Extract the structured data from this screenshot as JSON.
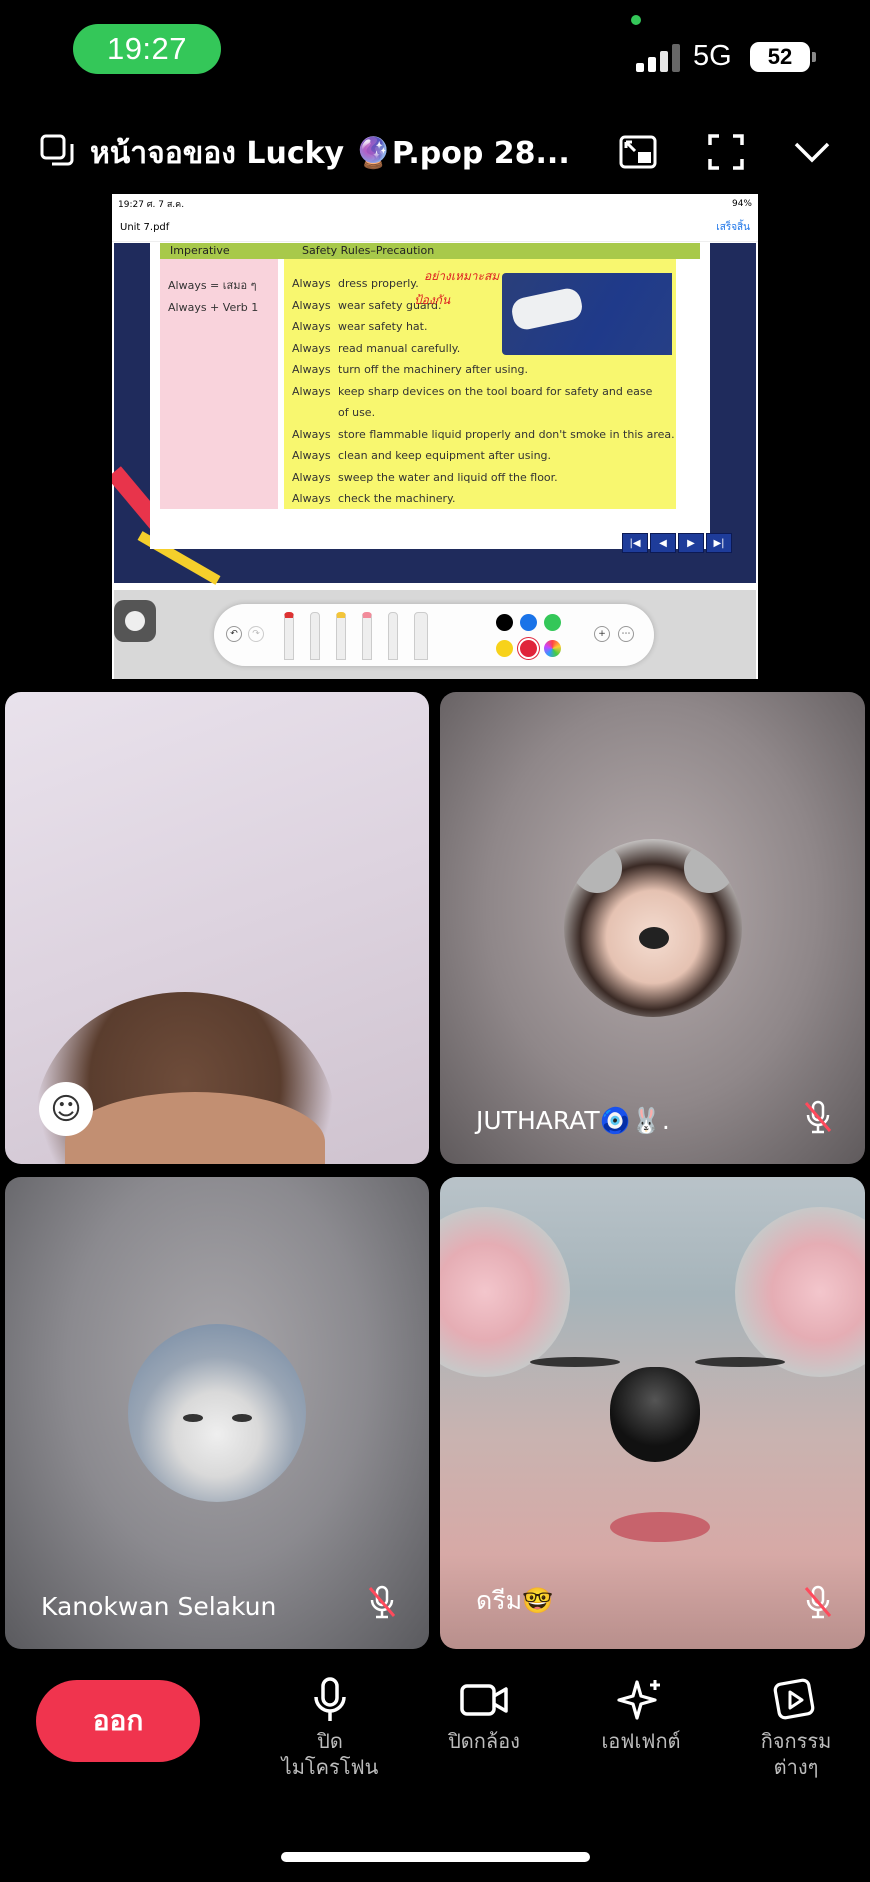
{
  "status_bar": {
    "time": "19:27",
    "network": "5G",
    "battery": "52"
  },
  "header": {
    "title": "หน้าจอของ Lucky 🔮P.pop 28..."
  },
  "shared_screen": {
    "ipad_time": "19:27  ศ. 7 ส.ค.",
    "ipad_battery": "94%",
    "file_name": "Unit 7.pdf",
    "done_label": "เสร็จสิ้น",
    "slide": {
      "col_left_header": "Imperative",
      "col_right_header": "Safety Rules–Precaution",
      "left_notes": [
        "Always  =  เสมอ ๆ",
        "Always  +  Verb 1"
      ],
      "rules": [
        {
          "aw": "Always",
          "text": "dress properly."
        },
        {
          "aw": "Always",
          "text": "wear safety guard."
        },
        {
          "aw": "Always",
          "text": "wear safety hat."
        },
        {
          "aw": "Always",
          "text": "read manual carefully."
        },
        {
          "aw": "Always",
          "text": "turn off the machinery after using."
        },
        {
          "aw": "Always",
          "text": "keep sharp devices on the tool board for safety and ease"
        },
        {
          "aw": "",
          "text": "of use."
        },
        {
          "aw": "Always",
          "text": "store flammable liquid properly and don't smoke in this area."
        },
        {
          "aw": "Always",
          "text": "clean and keep equipment after using."
        },
        {
          "aw": "Always",
          "text": "sweep the water and liquid off the floor."
        },
        {
          "aw": "Always",
          "text": "check the machinery."
        }
      ],
      "handwritten_1": "อย่างเหมาะสม",
      "handwritten_2": "ป้องกัน",
      "nav": [
        "|◀",
        "◀",
        "▶",
        "▶|"
      ]
    }
  },
  "participants": [
    {
      "name": ""
    },
    {
      "name": "JUTHARAT🧿🐰."
    },
    {
      "name": "Kanokwan Selakun"
    },
    {
      "name": "ดรีม🤓"
    }
  ],
  "controls": {
    "leave": "ออก",
    "mic": [
      "ปิด",
      "ไมโครโฟน"
    ],
    "camera": "ปิดกล้อง",
    "effects": "เอฟเฟกต์",
    "activities": [
      "กิจกรรม",
      "ต่างๆ"
    ]
  },
  "colors": {
    "leave": "#f0344e",
    "time_pill": "#34c759"
  }
}
